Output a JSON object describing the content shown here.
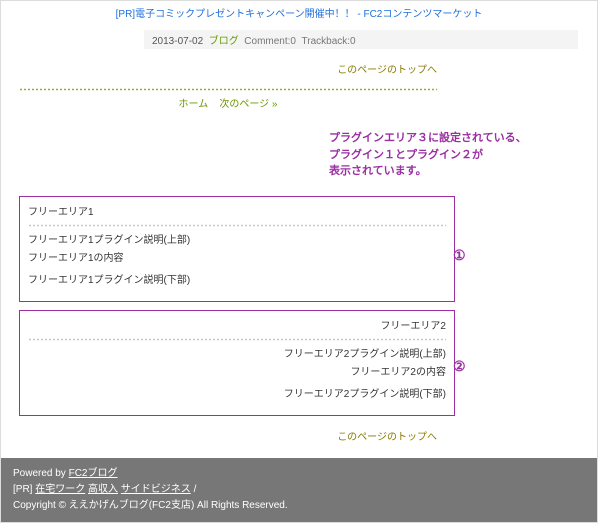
{
  "topbar": {
    "text": "[PR]電子コミックプレゼントキャンペーン開催中！！ - FC2コンテンツマーケット"
  },
  "meta": {
    "date": "2013-07-02",
    "category": "ブログ",
    "comment": "Comment:0",
    "trackback": "Trackback:0"
  },
  "links": {
    "top_of_page": "このページのトップへ",
    "home": "ホーム",
    "next": "次のページ »"
  },
  "annotation": {
    "text": "プラグインエリア３に設定されている、\nプラグイン１とプラグイン２が\n表示されています。",
    "mark1": "①",
    "mark2": "②"
  },
  "plugins": {
    "area1": {
      "title": "フリーエリア1",
      "p1": "フリーエリア1プラグイン説明(上部)",
      "p2": "フリーエリア1の内容",
      "p3": "フリーエリア1プラグイン説明(下部)"
    },
    "area2": {
      "title": "フリーエリア2",
      "p1": "フリーエリア2プラグイン説明(上部)",
      "p2": "フリーエリア2の内容",
      "p3": "フリーエリア2プラグイン説明(下部)"
    }
  },
  "footer": {
    "powered_prefix": "Powered by ",
    "powered_link": "FC2ブログ",
    "pr_prefix": "[PR] ",
    "pr_links": [
      "在宅ワーク",
      "高収入",
      "サイドビジネス"
    ],
    "slash": " /",
    "copyright": "Copyright © ええかげんブログ(FC2支店) All Rights Reserved."
  }
}
